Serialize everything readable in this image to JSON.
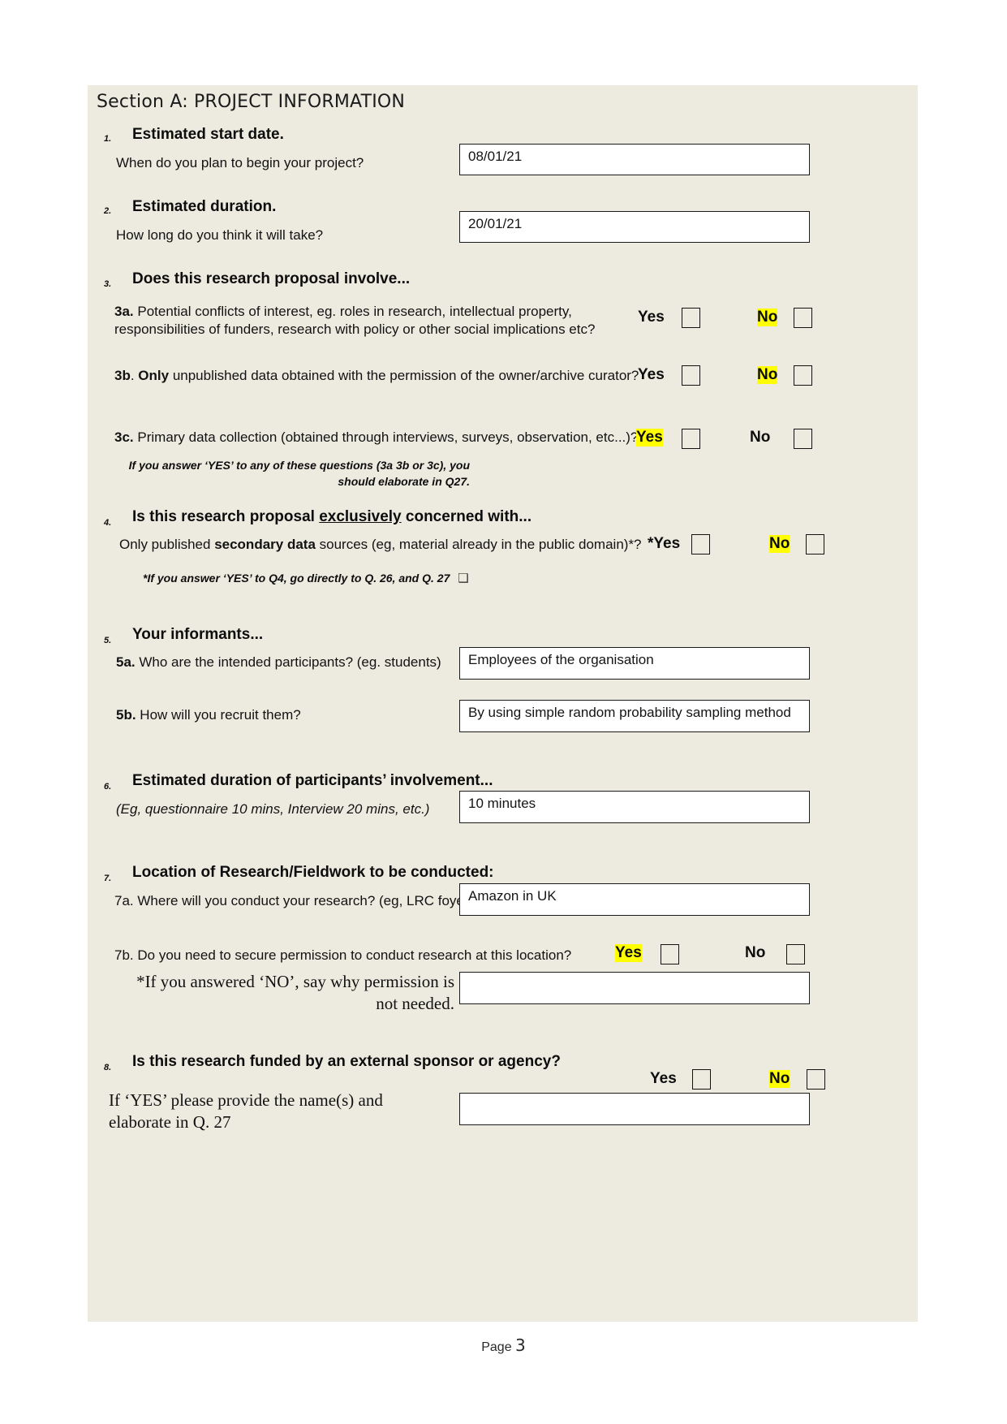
{
  "section": {
    "header": "Section A: PROJECT INFORMATION"
  },
  "questions": {
    "q1": {
      "number": "1.",
      "title": "Estimated start date.",
      "prompt": "When do you plan to begin your project?",
      "answer": "08/01/21"
    },
    "q2": {
      "number": "2.",
      "title": "Estimated duration.",
      "prompt": "How long do you think it will take?",
      "answer": "20/01/21"
    },
    "q3": {
      "number": "3.",
      "title": "Does this research proposal involve...",
      "a": {
        "label_bold": "3a.",
        "text_line1": "Potential conflicts of interest, eg. roles in research, intellectual property,",
        "text_line2": "responsibilities of funders, research with policy or other social implications etc?",
        "yes_label": "Yes",
        "no_label": "No",
        "yes_highlight": false,
        "no_highlight": true
      },
      "b": {
        "label_bold": "3b",
        "only_bold": "Only",
        "text": ". ",
        "text_rest": " unpublished data obtained with the permission of the owner/archive curator?",
        "yes_label": "Yes",
        "no_label": "No",
        "yes_highlight": false,
        "no_highlight": true
      },
      "c": {
        "label_bold": "3c.",
        "text": "Primary data collection (obtained through interviews, surveys, observation, etc...)?",
        "yes_label": "Yes",
        "no_label": "No",
        "yes_highlight": true,
        "no_highlight": false
      },
      "note_line1": "If you answer ‘YES’ to any of these questions (3a 3b or 3c), you should",
      "note_line2": "elaborate in Q27."
    },
    "q4": {
      "number": "4.",
      "title_pre": "Is this research proposal ",
      "title_underlined": "exclusively",
      "title_post": " concerned with...",
      "prompt_pre": "Only published ",
      "prompt_bold": "secondary data",
      "prompt_post": " sources (eg, material already in the public domain)*?",
      "yes_label": "*Yes",
      "no_label": "No",
      "yes_highlight": false,
      "no_highlight": true,
      "note": "*If you answer ‘YES’ to Q4, go directly to Q. 26, and Q. 27",
      "note_glyph": "❑"
    },
    "q5": {
      "number": "5.",
      "title": "Your informants...",
      "a": {
        "label_bold": "5a.",
        "text": "Who are the intended participants?  (eg. students)",
        "answer": "Employees of the organisation"
      },
      "b": {
        "label_bold": "5b.",
        "text": "How will you recruit them?",
        "answer": "By using simple random probability sampling method"
      }
    },
    "q6": {
      "number": "6.",
      "title": "Estimated duration of participants’ involvement...",
      "prompt": "(Eg, questionnaire 10 mins, Interview 20 mins, etc.)",
      "answer": "10 minutes"
    },
    "q7": {
      "number": "7.",
      "title": "Location of Research/Fieldwork to be conducted:",
      "a": {
        "label": "7a.",
        "text": "Where will you conduct your research?  (eg, LRC foyer)",
        "answer": "Amazon in UK"
      },
      "b": {
        "label": "7b.",
        "text": "Do you need to secure permission to conduct research at this location?",
        "yes_label": "Yes",
        "no_label": "No",
        "yes_highlight": true,
        "no_highlight": false
      },
      "c": {
        "note_line1": "*If you answered ‘NO’, say why permission is",
        "note_line2": "not needed.",
        "answer": ""
      }
    },
    "q8": {
      "number": "8.",
      "title": "Is this research funded by an external sponsor or agency?",
      "yes_label": "Yes",
      "no_label": "No",
      "yes_highlight": false,
      "no_highlight": true,
      "prompt_line1": "If ‘YES’ please provide the name(s) and",
      "prompt_line2": "elaborate in Q. 27",
      "answer": ""
    }
  },
  "footer": {
    "label": "Page ",
    "page_number": "3"
  },
  "colors": {
    "page_background": "#edebe0",
    "highlight": "#ffff00",
    "field_background": "#ffffff",
    "border": "#1b1b1b",
    "text": "#121212"
  }
}
